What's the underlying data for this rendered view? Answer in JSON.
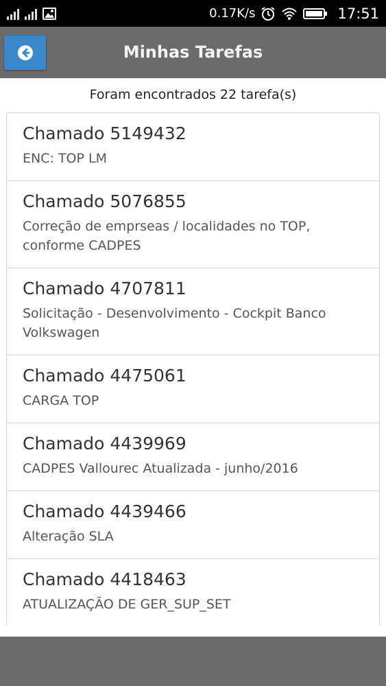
{
  "status_bar": {
    "speed": "0.17K/s",
    "time": "17:51",
    "icons": [
      "signal-icon",
      "signal-icon-2",
      "image-icon",
      "alarm-icon",
      "wifi-icon",
      "battery-icon"
    ]
  },
  "header": {
    "title": "Minhas Tarefas",
    "back_icon": "arrow-left-circle-icon"
  },
  "result_count": "Foram encontrados 22 tarefa(s)",
  "tasks": [
    {
      "title": "Chamado 5149432",
      "description": "ENC: TOP LM"
    },
    {
      "title": "Chamado 5076855",
      "description": "Correção de emprseas / localidades no TOP, conforme CADPES"
    },
    {
      "title": "Chamado 4707811",
      "description": "Solicitação - Desenvolvimento - Cockpit Banco Volkswagen"
    },
    {
      "title": "Chamado 4475061",
      "description": "CARGA TOP"
    },
    {
      "title": "Chamado 4439969",
      "description": "CADPES Vallourec Atualizada - junho/2016"
    },
    {
      "title": "Chamado 4439466",
      "description": "Alteração SLA"
    },
    {
      "title": "Chamado 4418463",
      "description": "ATUALIZAÇÃO DE GER_SUP_SET"
    }
  ],
  "colors": {
    "header_bg": "#6b6b6b",
    "back_button_bg": "#3a88c9",
    "status_bar_bg": "#000000"
  }
}
